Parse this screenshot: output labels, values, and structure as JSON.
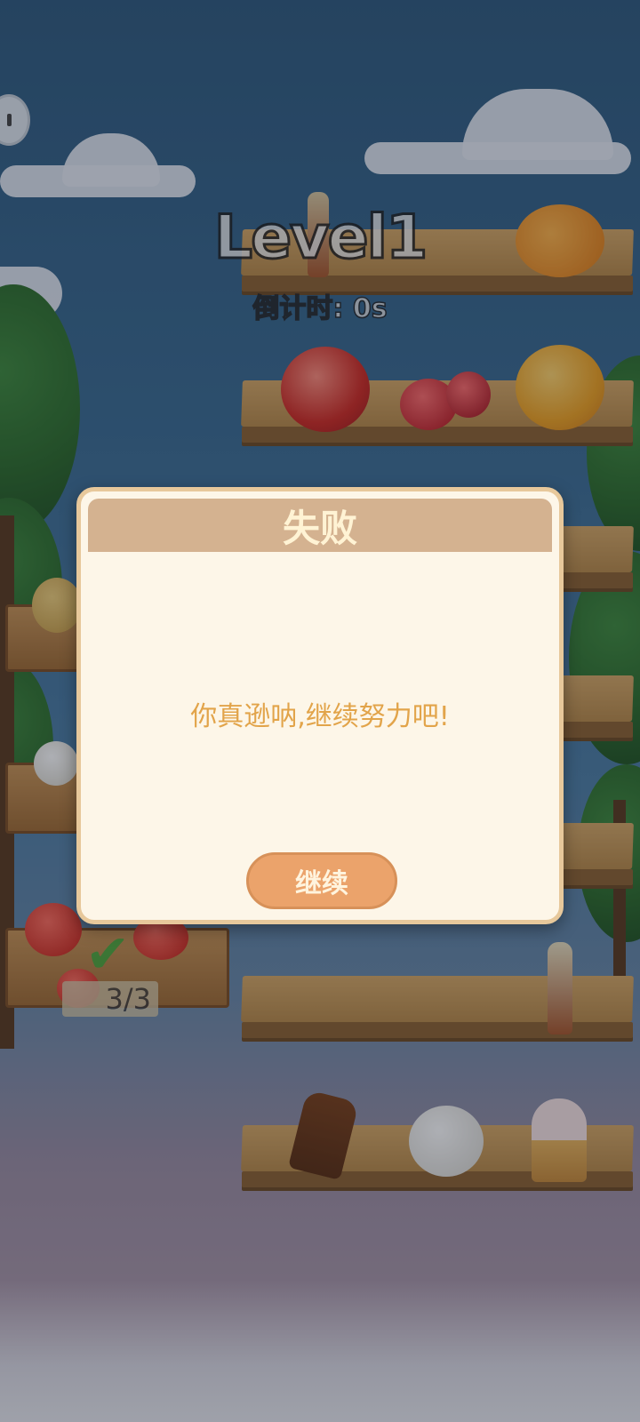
{
  "header": {
    "level_title": "Level1",
    "countdown": "倒计时: 0s"
  },
  "progress": {
    "counter_text": "3/3"
  },
  "dialog": {
    "title": "失败",
    "message": "你真逊呐,继续努力吧!",
    "continue_label": "继续"
  },
  "shelf_items": [
    {
      "shelf": 1,
      "items": [
        "soda-bottle",
        "pumpkin"
      ]
    },
    {
      "shelf": 2,
      "items": [
        "apple",
        "cherries",
        "peach"
      ]
    },
    {
      "shelf": 3,
      "items": [
        "soda-bottle"
      ]
    },
    {
      "shelf": 4,
      "items": [
        "ice-cream-bar",
        "garlic",
        "ice-cream-cone"
      ]
    }
  ],
  "crate_items": [
    "potato",
    "garlic",
    "tomato"
  ],
  "colors": {
    "dialog_bg": "#fdf6e8",
    "dialog_header": "#d4b290",
    "message_text": "#e2a44a",
    "button_bg": "#eba36b"
  }
}
